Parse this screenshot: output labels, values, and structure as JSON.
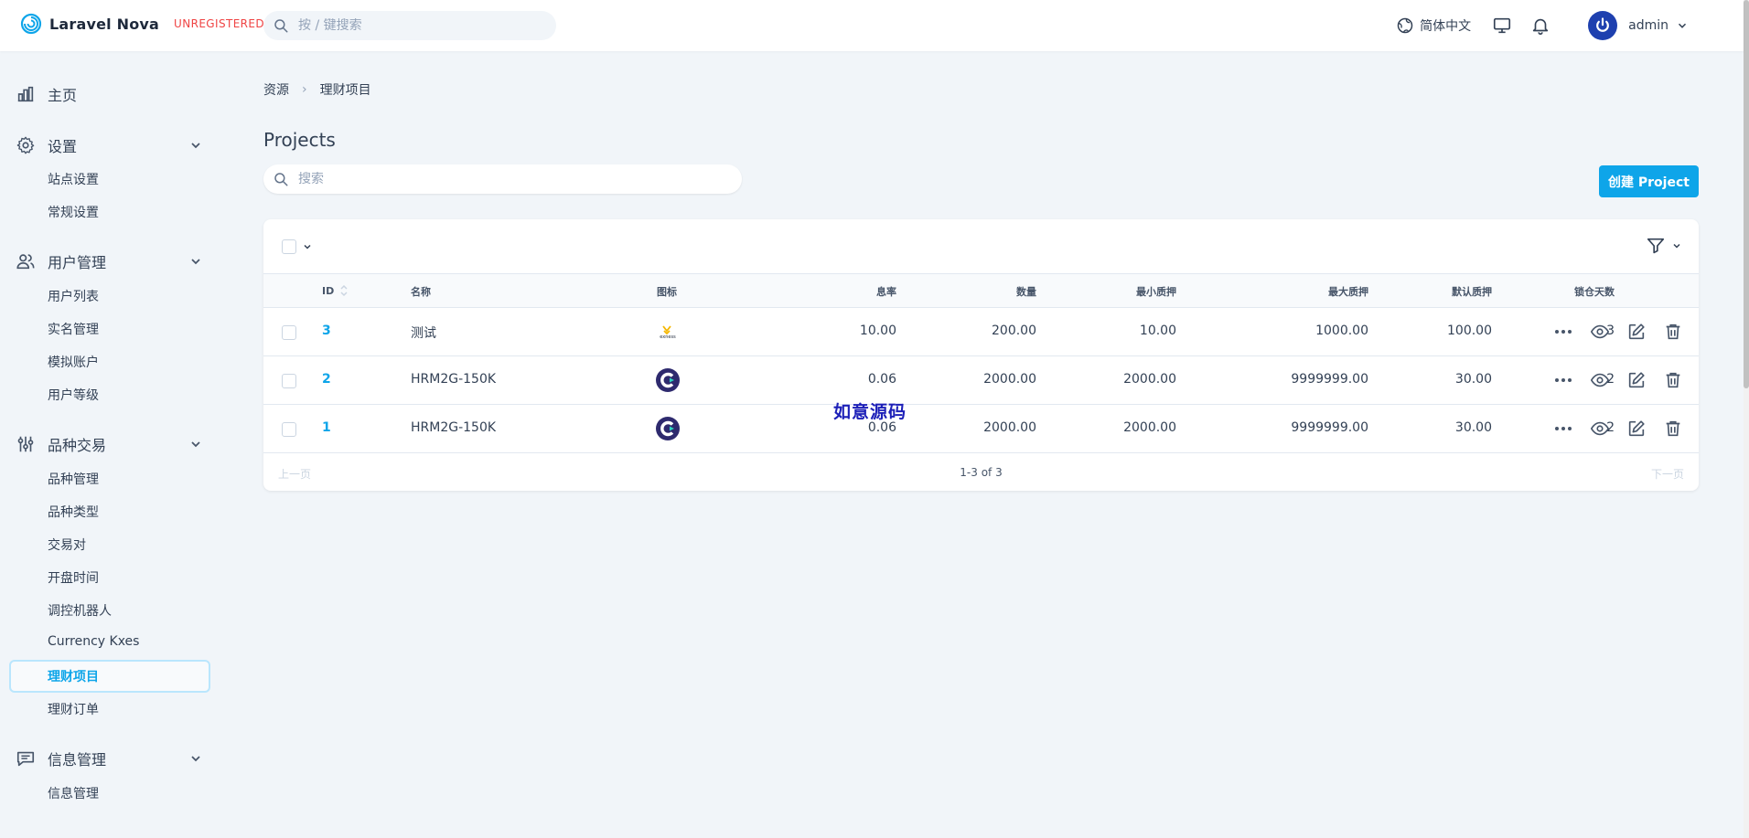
{
  "header": {
    "brand_name": "Laravel Nova",
    "unregistered": "UNREGISTERED",
    "search_placeholder": "按 / 键搜索",
    "language": "简体中文",
    "username": "admin"
  },
  "sidebar": {
    "home": "主页",
    "settings": {
      "label": "设置",
      "items": [
        "站点设置",
        "常规设置"
      ]
    },
    "users": {
      "label": "用户管理",
      "items": [
        "用户列表",
        "实名管理",
        "模拟账户",
        "用户等级"
      ]
    },
    "trading": {
      "label": "品种交易",
      "items": [
        "品种管理",
        "品种类型",
        "交易对",
        "开盘时间",
        "调控机器人",
        "Currency Kxes",
        "理财项目",
        "理财订单"
      ]
    },
    "messages": {
      "label": "信息管理",
      "items": [
        "信息管理"
      ]
    },
    "active_item": "理财项目"
  },
  "breadcrumb": [
    "资源",
    "理财项目"
  ],
  "page_title": "Projects",
  "search": {
    "placeholder": "搜索"
  },
  "create_button": "创建 Project",
  "table": {
    "columns": [
      "ID",
      "名称",
      "图标",
      "息率",
      "数量",
      "最小质押",
      "最大质押",
      "默认质押",
      "锁仓天数"
    ],
    "rows": [
      {
        "id": "3",
        "name": "测试",
        "icon": "exness-logo",
        "rate": "10.00",
        "amount": "200.00",
        "min": "10.00",
        "max": "1000.00",
        "default": "100.00",
        "days": "3"
      },
      {
        "id": "2",
        "name": "HRM2G-150K",
        "icon": "c-logo",
        "rate": "0.06",
        "amount": "2000.00",
        "min": "2000.00",
        "max": "9999999.00",
        "default": "30.00",
        "days": "2"
      },
      {
        "id": "1",
        "name": "HRM2G-150K",
        "icon": "c-logo",
        "rate": "0.06",
        "amount": "2000.00",
        "min": "2000.00",
        "max": "9999999.00",
        "default": "30.00",
        "days": "2"
      }
    ]
  },
  "pagination": {
    "prev": "上一页",
    "count": "1-3 of 3",
    "next": "下一页"
  },
  "watermark": "如意源码",
  "colors": {
    "accent": "#0ea5e9",
    "unregistered": "#ef4444",
    "avatar": "#1e40af",
    "watermark": "#1d20b8"
  }
}
